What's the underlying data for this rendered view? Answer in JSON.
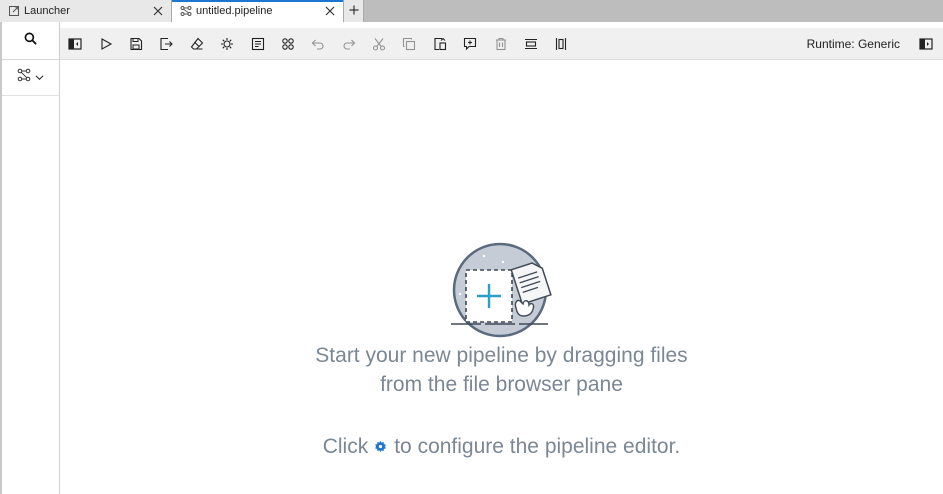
{
  "tabs": [
    {
      "label": "Launcher",
      "icon": "launch-icon"
    },
    {
      "label": "untitled.pipeline",
      "icon": "pipeline-icon"
    }
  ],
  "toolbar": {
    "runtime_label": "Runtime: Generic",
    "buttons": [
      {
        "name": "toggle-panel",
        "enabled": true
      },
      {
        "name": "run-pipeline",
        "enabled": true
      },
      {
        "name": "save-pipeline",
        "enabled": true
      },
      {
        "name": "export-pipeline",
        "enabled": true
      },
      {
        "name": "clear-pipeline",
        "enabled": true
      },
      {
        "name": "open-runtimes",
        "enabled": true
      },
      {
        "name": "open-runtime-images",
        "enabled": true
      },
      {
        "name": "open-component-catalogs",
        "enabled": true
      },
      {
        "name": "undo",
        "enabled": false
      },
      {
        "name": "redo",
        "enabled": false
      },
      {
        "name": "cut",
        "enabled": false
      },
      {
        "name": "copy",
        "enabled": false
      },
      {
        "name": "paste",
        "enabled": true
      },
      {
        "name": "add-comment",
        "enabled": true
      },
      {
        "name": "delete",
        "enabled": false
      },
      {
        "name": "arrange-horizontally",
        "enabled": true
      },
      {
        "name": "arrange-vertically",
        "enabled": true
      }
    ]
  },
  "canvas": {
    "line1": "Start your new pipeline by dragging files",
    "line2": "from the file browser pane",
    "line3_before": "Click",
    "line3_after": "to configure the pipeline editor."
  },
  "colors": {
    "accent": "#1976d2",
    "message": "#7b8794",
    "illustration_bg": "#c5ccd6",
    "plus": "#2aa0c8"
  }
}
